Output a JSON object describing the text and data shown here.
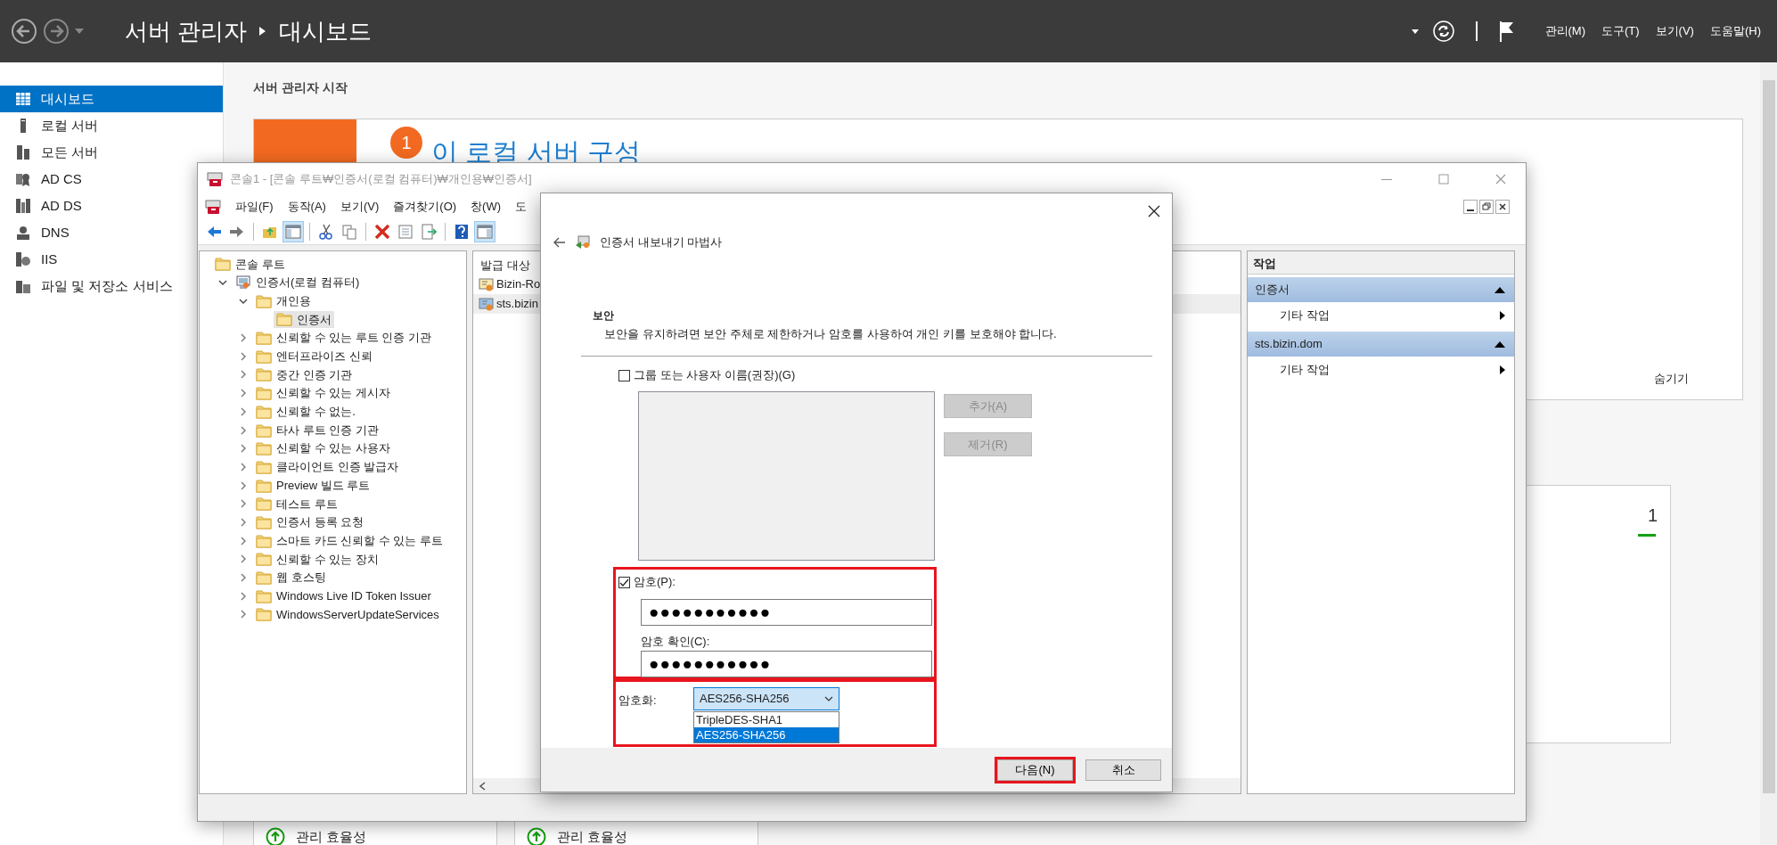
{
  "server_manager": {
    "title": "서버 관리자",
    "page": "대시보드",
    "menus": [
      "관리(M)",
      "도구(T)",
      "보기(V)",
      "도움말(H)"
    ],
    "sidebar": [
      {
        "label": "대시보드",
        "selected": true
      },
      {
        "label": "로컬 서버",
        "selected": false
      },
      {
        "label": "모든 서버",
        "selected": false
      },
      {
        "label": "AD CS",
        "selected": false
      },
      {
        "label": "AD DS",
        "selected": false
      },
      {
        "label": "DNS",
        "selected": false
      },
      {
        "label": "IIS",
        "selected": false
      },
      {
        "label": "파일 및 저장소 서비스",
        "selected": false
      }
    ],
    "heading": "서버 관리자 시작",
    "welcome": {
      "step_number": "1",
      "step_title": "이 로컬 서버 구성",
      "hide_link": "숨기기"
    },
    "tile": {
      "count": "1"
    },
    "bottom_tiles": [
      {
        "label": "관리 효율성"
      },
      {
        "label": "관리 효율성"
      }
    ]
  },
  "console": {
    "title": "콘솔1 - [콘솔 루트₩인증서(로컬 컴퓨터)₩개인용₩인증서]",
    "menus": [
      "파일(F)",
      "동작(A)",
      "보기(V)",
      "즐겨찾기(O)",
      "창(W)",
      "도"
    ],
    "toolbar": [
      {
        "selected": false
      },
      {
        "selected": false
      },
      {
        "selected": false
      },
      {
        "selected": true
      },
      {
        "selected": false
      },
      {
        "selected": false
      },
      {
        "selected": false
      },
      {
        "selected": false
      },
      {
        "selected": false
      },
      {
        "selected": false
      },
      {
        "selected": true
      }
    ],
    "tree": [
      {
        "label": "콘솔 루트",
        "selected": false,
        "children": [
          {
            "label": "인증서(로컬 컴퓨터)",
            "selected": false,
            "expanded": true,
            "children": [
              {
                "label": "개인용",
                "selected": false,
                "expanded": true,
                "children": [
                  {
                    "label": "인증서",
                    "selected": true
                  }
                ]
              },
              {
                "label": "신뢰할 수 있는 루트 인증 기관",
                "selected": false,
                "expanded": false
              },
              {
                "label": "엔터프라이즈 신뢰",
                "selected": false,
                "expanded": false
              },
              {
                "label": "중간 인증 기관",
                "selected": false,
                "expanded": false
              },
              {
                "label": "신뢰할 수 있는 게시자",
                "selected": false,
                "expanded": false
              },
              {
                "label": "신뢰할 수 없는.",
                "selected": false,
                "expanded": false
              },
              {
                "label": "타사 루트 인증 기관",
                "selected": false,
                "expanded": false
              },
              {
                "label": "신뢰할 수 있는 사용자",
                "selected": false,
                "expanded": false
              },
              {
                "label": "클라이언트 인증 발급자",
                "selected": false,
                "expanded": false
              },
              {
                "label": "Preview 빌드 루트",
                "selected": false,
                "expanded": false
              },
              {
                "label": "테스트 루트",
                "selected": false,
                "expanded": false
              },
              {
                "label": "인증서 등록 요청",
                "selected": false,
                "expanded": false
              },
              {
                "label": "스마트 카드 신뢰할 수 있는 루트",
                "selected": false,
                "expanded": false
              },
              {
                "label": "신뢰할 수 있는 장치",
                "selected": false,
                "expanded": false
              },
              {
                "label": "웹 호스팅",
                "selected": false,
                "expanded": false
              },
              {
                "label": "Windows Live ID Token Issuer",
                "selected": false,
                "expanded": false
              },
              {
                "label": "WindowsServerUpdateServices",
                "selected": false,
                "expanded": false
              }
            ]
          }
        ]
      }
    ],
    "list": {
      "column": "발급 대상",
      "rows": [
        {
          "name": "Bizin-Ro",
          "selected": false
        },
        {
          "name": "sts.bizin",
          "selected": true
        }
      ]
    },
    "actions": {
      "header": "작업",
      "groups": [
        {
          "title": "인증서",
          "expanded": true,
          "items": [
            "기타 작업"
          ]
        },
        {
          "title": "sts.bizin.dom",
          "expanded": true,
          "items": [
            "기타 작업"
          ]
        }
      ]
    }
  },
  "wizard": {
    "title": "인증서 내보내기 마법사",
    "section": "보안",
    "description": "보안을 유지하려면 보안 주체로 제한하거나 암호를 사용하여 개인 키를 보호해야 합니다.",
    "group_option": {
      "label": "그룹 또는 사용자 이름(권장)(G)",
      "checked": false
    },
    "group_buttons": [
      {
        "label": "추가(A)",
        "disabled": true
      },
      {
        "label": "제거(R)",
        "disabled": true
      }
    ],
    "password": {
      "highlighted": true,
      "label": "암호(P):",
      "checked": true,
      "value": "●●●●●●●●●●●",
      "confirm_label": "암호 확인(C):",
      "confirm_value": "●●●●●●●●●●●"
    },
    "encryption": {
      "highlighted": true,
      "label": "암호화:",
      "value": "AES256-SHA256",
      "expanded": true,
      "options": [
        {
          "label": "TripleDES-SHA1",
          "selected": false
        },
        {
          "label": "AES256-SHA256",
          "selected": true
        }
      ]
    },
    "buttons": [
      {
        "label": "다음(N)",
        "highlighted": true
      },
      {
        "label": "취소",
        "highlighted": false
      }
    ]
  }
}
